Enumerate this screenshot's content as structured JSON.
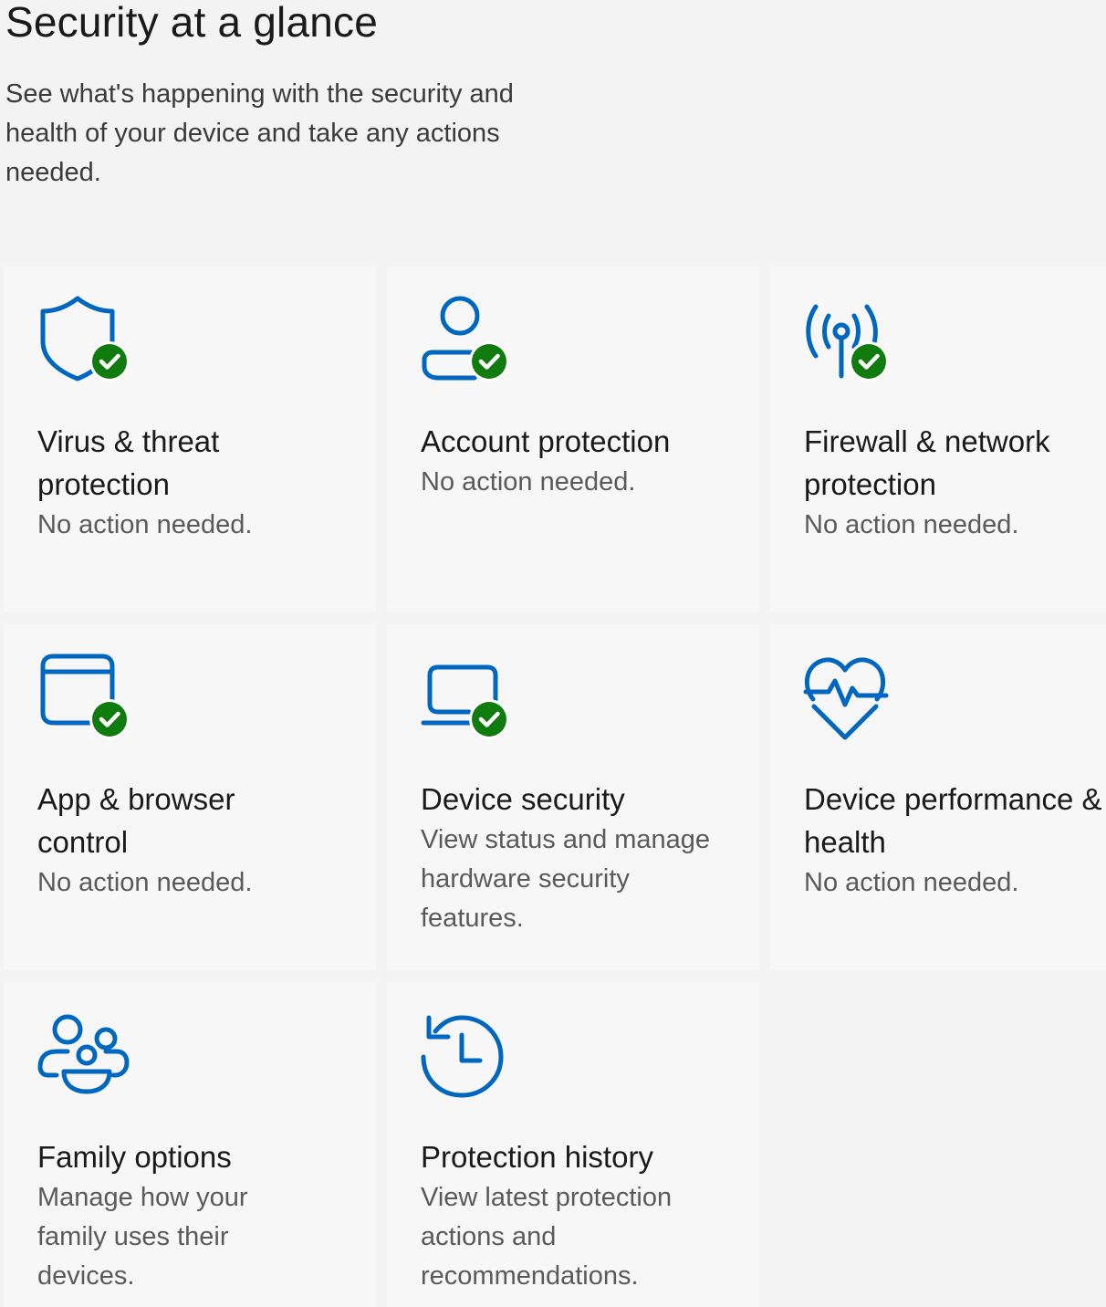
{
  "header": {
    "title": "Security at a glance",
    "subtitle": "See what's happening with the security and health of your device and take any actions needed."
  },
  "colors": {
    "accent": "#0067c0",
    "ok_badge": "#107c10",
    "tile_background": "#f7f7f7",
    "page_background": "#f3f3f3"
  },
  "tiles": [
    {
      "id": "virus",
      "icon": "shield-icon",
      "status_badge": "check-badge-icon",
      "title": "Virus & threat protection",
      "description": "No action needed."
    },
    {
      "id": "account",
      "icon": "person-icon",
      "status_badge": "check-badge-icon",
      "title": "Account protection",
      "description": "No action needed."
    },
    {
      "id": "firewall",
      "icon": "antenna-icon",
      "status_badge": "check-badge-icon",
      "title": "Firewall & network protection",
      "description": "No action needed."
    },
    {
      "id": "app-browser",
      "icon": "browser-window-icon",
      "status_badge": "check-badge-icon",
      "title": "App & browser control",
      "description": "No action needed."
    },
    {
      "id": "device-security",
      "icon": "laptop-icon",
      "status_badge": "check-badge-icon",
      "title": "Device security",
      "description": "View status and manage hardware security features."
    },
    {
      "id": "device-health",
      "icon": "heart-pulse-icon",
      "status_badge": "",
      "title": "Device performance & health",
      "description": "No action needed."
    },
    {
      "id": "family",
      "icon": "family-icon",
      "status_badge": "",
      "title": "Family options",
      "description": "Manage how your family uses their devices."
    },
    {
      "id": "history",
      "icon": "history-clock-icon",
      "status_badge": "",
      "title": "Protection history",
      "description": "View latest protection actions and recommendations."
    }
  ]
}
